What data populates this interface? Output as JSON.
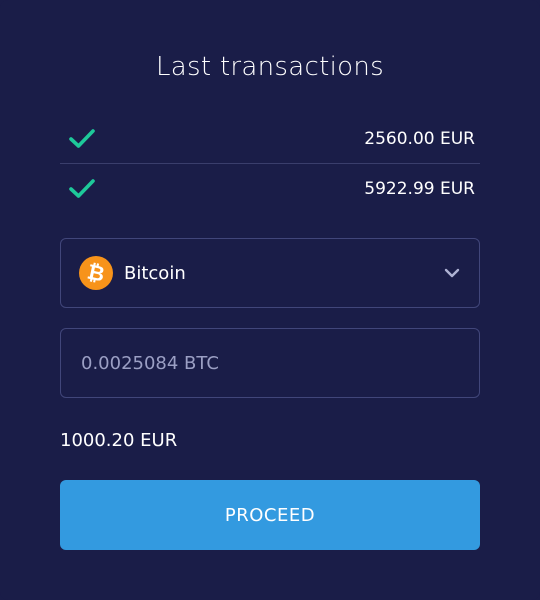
{
  "title": "Last transactions",
  "transactions": [
    {
      "amount": "2560.00 EUR",
      "status": "completed",
      "icon": "check-icon"
    },
    {
      "amount": "5922.99 EUR",
      "status": "completed",
      "icon": "check-icon"
    }
  ],
  "currency_select": {
    "selected": "Bitcoin",
    "icon": "bitcoin-icon",
    "caret_icon": "chevron-down-icon"
  },
  "amount_input": {
    "placeholder": "0.0025084 BTC",
    "value": ""
  },
  "total": "1000.20 EUR",
  "proceed_label": "PROCEED",
  "colors": {
    "background": "#1a1d48",
    "check": "#1ec99a",
    "bitcoin": "#f7931a",
    "button": "#339ae0",
    "border": "#41467a"
  }
}
